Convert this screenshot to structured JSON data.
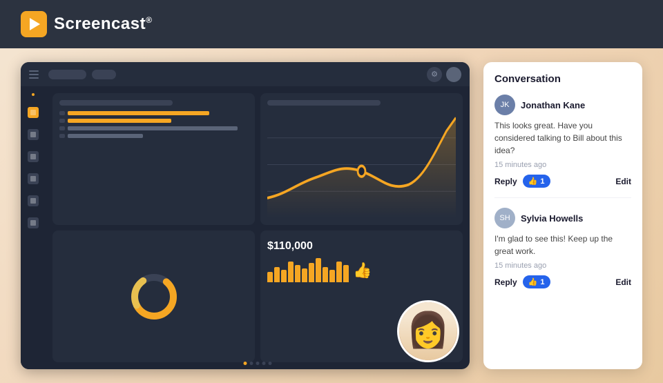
{
  "header": {
    "logo_text": "Screencast",
    "logo_reg": "®"
  },
  "dashboard": {
    "bar_rows": [
      {
        "width": "75%",
        "dim": false
      },
      {
        "width": "55%",
        "dim": false
      },
      {
        "width": "90%",
        "dim": true
      },
      {
        "width": "40%",
        "dim": true
      }
    ],
    "stat_number": "$110,000",
    "mini_bar_heights": [
      15,
      22,
      18,
      30,
      25,
      20,
      28,
      35,
      22,
      18,
      30,
      25
    ]
  },
  "conversation": {
    "title": "Conversation",
    "comments": [
      {
        "id": "jonathan",
        "name": "Jonathan Kane",
        "initials": "JK",
        "text": "This looks great. Have you considered talking to Bill about this idea?",
        "time": "15 minutes ago",
        "likes": 1,
        "reply_label": "Reply",
        "edit_label": "Edit"
      },
      {
        "id": "sylvia",
        "name": "Sylvia Howells",
        "initials": "SH",
        "text": "I'm glad to see this! Keep up the great work.",
        "time": "15 minutes ago",
        "likes": 1,
        "reply_label": "Reply",
        "edit_label": "Edit"
      }
    ]
  }
}
